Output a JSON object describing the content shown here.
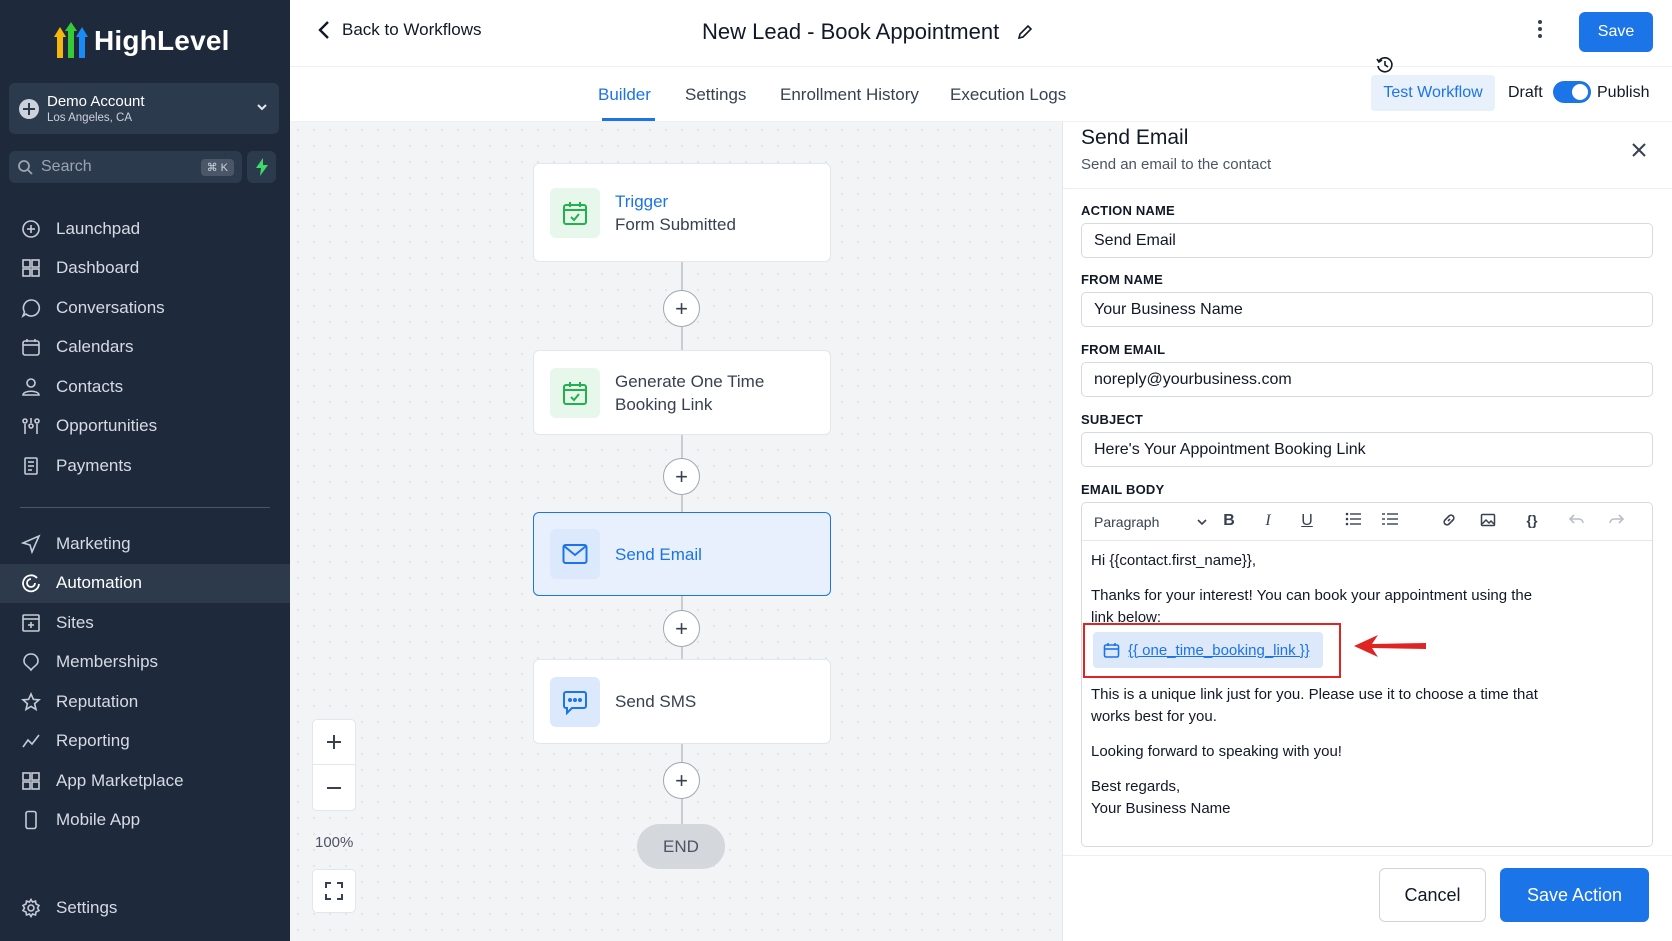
{
  "brand": {
    "name": "HighLevel"
  },
  "account": {
    "name": "Demo Account",
    "location": "Los Angeles, CA"
  },
  "search": {
    "placeholder": "Search",
    "shortcut": "⌘ K"
  },
  "sidebar": {
    "items": [
      {
        "label": "Launchpad",
        "icon": "launchpad-icon"
      },
      {
        "label": "Dashboard",
        "icon": "dashboard-icon"
      },
      {
        "label": "Conversations",
        "icon": "chat-icon"
      },
      {
        "label": "Calendars",
        "icon": "calendar-icon"
      },
      {
        "label": "Contacts",
        "icon": "contacts-icon"
      },
      {
        "label": "Opportunities",
        "icon": "opportunities-icon"
      },
      {
        "label": "Payments",
        "icon": "receipt-icon"
      }
    ],
    "items2": [
      {
        "label": "Marketing",
        "icon": "send-icon"
      },
      {
        "label": "Automation",
        "icon": "automation-icon",
        "active": true
      },
      {
        "label": "Sites",
        "icon": "sites-icon"
      },
      {
        "label": "Memberships",
        "icon": "memberships-icon"
      },
      {
        "label": "Reputation",
        "icon": "star-icon"
      },
      {
        "label": "Reporting",
        "icon": "reporting-icon"
      },
      {
        "label": "App Marketplace",
        "icon": "grid-icon"
      },
      {
        "label": "Mobile App",
        "icon": "phone-icon"
      }
    ],
    "settings": "Settings"
  },
  "header": {
    "back_label": "Back to Workflows",
    "title": "New Lead - Book Appointment",
    "save_label": "Save"
  },
  "tabs": [
    "Builder",
    "Settings",
    "Enrollment History",
    "Execution Logs"
  ],
  "active_tab": "Builder",
  "controls": {
    "test_workflow": "Test Workflow",
    "draft": "Draft",
    "publish": "Publish",
    "published": true
  },
  "workflow": {
    "nodes": [
      {
        "title": "Trigger",
        "subtitle": "Form Submitted"
      },
      {
        "line1": "Generate One Time",
        "line2": "Booking Link"
      },
      {
        "title": "Send Email",
        "selected": true
      },
      {
        "title": "Send SMS"
      }
    ],
    "end_label": "END",
    "zoom": "100%"
  },
  "panel": {
    "title": "Send Email",
    "subtitle": "Send an email to the contact",
    "fields": {
      "action_name": {
        "label": "ACTION NAME",
        "value": "Send Email"
      },
      "from_name": {
        "label": "FROM NAME",
        "value": "Your Business Name"
      },
      "from_email": {
        "label": "FROM EMAIL",
        "value": "noreply@yourbusiness.com"
      },
      "subject": {
        "label": "SUBJECT",
        "value": "Here's Your Appointment Booking Link"
      }
    },
    "email_body": {
      "label": "EMAIL BODY",
      "format": "Paragraph",
      "greeting": "Hi {{contact.first_name}},",
      "para1_line1": "Thanks for your interest! You can book your appointment using the",
      "para1_line2": "link below:",
      "link": "{{ one_time_booking_link }}",
      "para2_line1": "This is a unique link just for you. Please use it to choose a time that",
      "para2_line2": "works best for you.",
      "para3": "Looking forward to speaking with you!",
      "signoff": "Best regards,",
      "signature": "Your Business Name"
    },
    "cancel_label": "Cancel",
    "save_action_label": "Save Action"
  },
  "colors": {
    "accent": "#1b74e8",
    "sidebar_bg": "#1e2a3b",
    "highlight": "#e02424"
  }
}
